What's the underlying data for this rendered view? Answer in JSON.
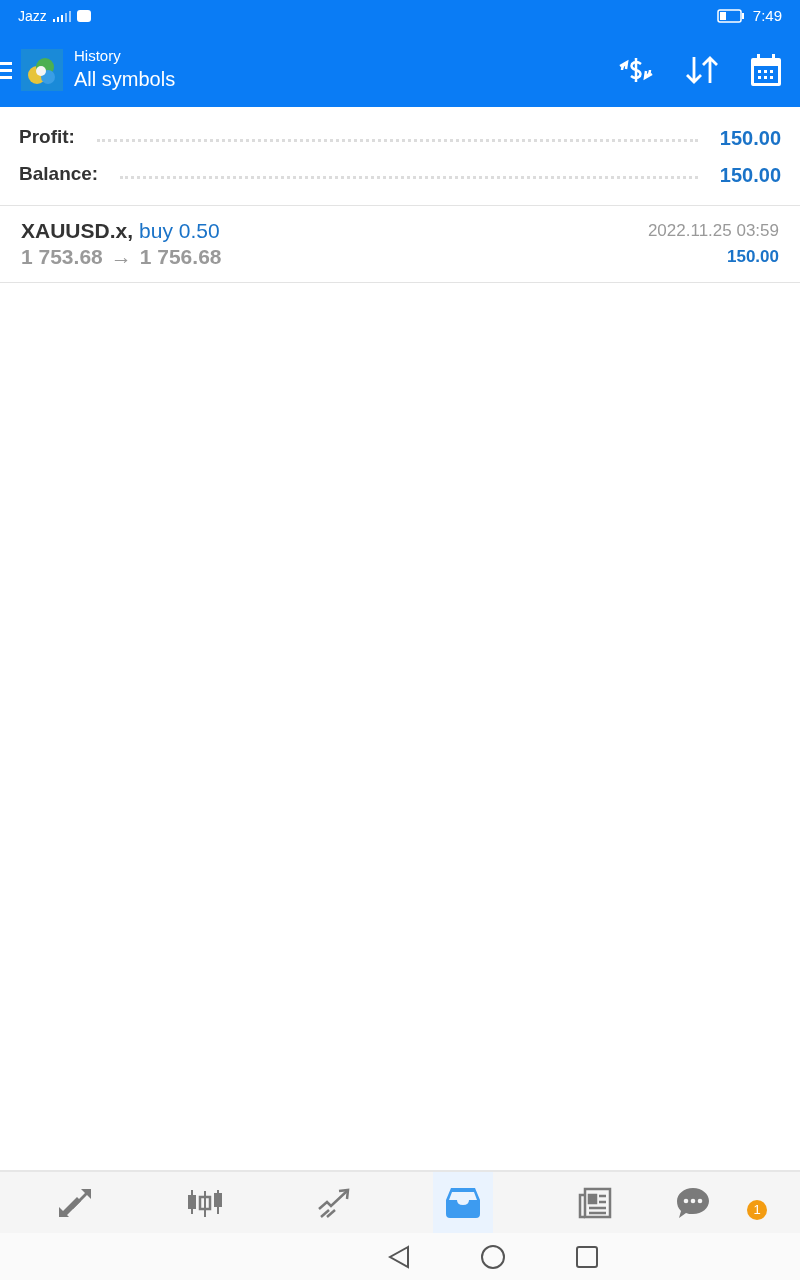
{
  "status_bar": {
    "carrier": "Jazz",
    "time": "7:49"
  },
  "header": {
    "subtitle": "History",
    "title": "All symbols"
  },
  "summary": [
    {
      "label": "Profit:",
      "value": "150.00"
    },
    {
      "label": "Balance:",
      "value": "150.00"
    }
  ],
  "deals": [
    {
      "symbol": "XAUUSD.x,",
      "side": "buy 0.50",
      "open_price": "1 753.68",
      "arrow": "→",
      "close_price": "1 756.68",
      "time": "2022.11.25 03:59",
      "profit": "150.00"
    }
  ],
  "tabs": [
    {
      "kind": "quotes",
      "selected": false
    },
    {
      "kind": "chart",
      "selected": false
    },
    {
      "kind": "trade",
      "selected": false
    },
    {
      "kind": "history",
      "selected": true
    },
    {
      "kind": "news",
      "selected": false
    },
    {
      "kind": "chat",
      "selected": false,
      "badge": "1"
    }
  ]
}
